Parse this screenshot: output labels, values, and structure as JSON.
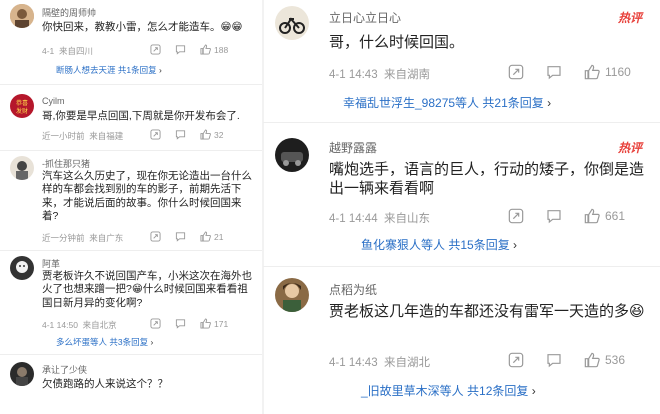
{
  "left": {
    "comments": [
      {
        "user": "隔壁的周师帅",
        "text": "你快回来，教教小雷，怎么才能造车。",
        "date": "4-1",
        "location": "来自四川",
        "likes": "188",
        "reply_names": "断肠人想去天涯",
        "reply_count": "共1条回复"
      },
      {
        "user": "Cyilm",
        "text": "哥,你要是早点回国,下周就是你开发布会了.",
        "date": "近一小时前",
        "location": "来自福建",
        "likes": "32",
        "reply_names": "",
        "reply_count": ""
      },
      {
        "user": "-抓住那只猪",
        "text": "汽车这么久历史了，现在你无论造出一台什么样的车都会找到别的车的影子，前期先活下来，才能说后面的故事。你什么时候回国来着?",
        "date": "近一分钟前",
        "location": "来自广东",
        "likes": "21",
        "reply_names": "",
        "reply_count": ""
      },
      {
        "user": "阿革",
        "text": "贾老板许久不说回国产车，小米这次在海外也火了也想来蹭一把?",
        "text2": "什么时候回国来看看祖国日新月异的变化啊?",
        "date": "4-1 14:50",
        "location": "来自北京",
        "likes": "171",
        "reply_names": "多么坏蛋等人",
        "reply_count": "共3条回复"
      },
      {
        "user": "承让了少侠",
        "text": "欠债跑路的人来说这个？？",
        "date": "",
        "location": "",
        "likes": "",
        "reply_names": "",
        "reply_count": ""
      }
    ]
  },
  "right": {
    "comments": [
      {
        "user": "立日心立日心",
        "badge": "热评",
        "text": "哥，什么时候回国。",
        "date": "4-1 14:43",
        "location": "来自湖南",
        "likes": "1160",
        "reply_names": "幸福乱世浮生_98275等人",
        "reply_count": "共21条回复"
      },
      {
        "user": "越野露露",
        "badge": "热评",
        "text": "嘴炮选手，语言的巨人，行动的矮子，你倒是造出一辆来看看啊",
        "date": "4-1 14:44",
        "location": "来自山东",
        "likes": "661",
        "reply_names": "鱼化寨狠人等人",
        "reply_count": "共15条回复"
      },
      {
        "user": "点稻为纸",
        "badge": "",
        "text": "贾老板这几年造的车都还没有雷军一天造的多",
        "date": "4-1 14:43",
        "location": "来自湖北",
        "likes": "536",
        "reply_names": "_旧故里草木深等人",
        "reply_count": "共12条回复"
      }
    ]
  },
  "icons": {
    "share": "share-icon",
    "comment": "comment-icon",
    "like": "thumb-up-icon",
    "laugh": "laugh-emoji-icon"
  },
  "colors": {
    "hot": "#e8413b",
    "link": "#2a6fc6",
    "meta": "#999999"
  }
}
